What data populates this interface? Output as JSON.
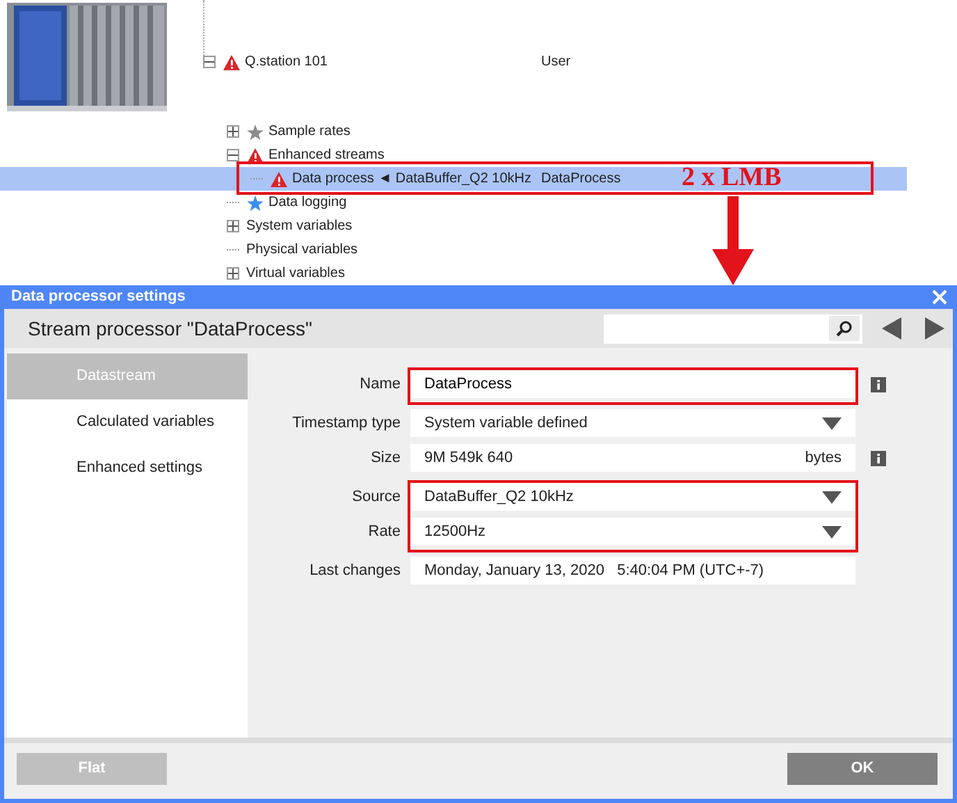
{
  "tree": {
    "items": [
      {
        "label": "Q.station 101",
        "column_2": "User",
        "kind": "alert",
        "expanded": true,
        "selected": false,
        "children": [
          {
            "label": "Sample rates",
            "kind": "setting",
            "expanded": false,
            "selected": false
          },
          {
            "label": "Enhanced streams",
            "kind": "alert",
            "expanded": true,
            "selected": false,
            "children": [
              {
                "label": "Data process ◄ DataBuffer_Q2 10kHz",
                "column_2": "DataProcess",
                "kind": "alert",
                "selected": true
              }
            ]
          },
          {
            "label": "Data logging",
            "kind": "logging",
            "selected": false
          },
          {
            "label": "System variables",
            "expanded": false,
            "selected": false
          },
          {
            "label": "Physical variables",
            "selected": false
          },
          {
            "label": "Virtual variables",
            "expanded": false,
            "selected": false
          }
        ]
      }
    ]
  },
  "annotation": {
    "label": "2 x LMB"
  },
  "dialog": {
    "title": "Data processor settings",
    "heading": "Stream processor \"DataProcess\"",
    "sidebar": {
      "items": [
        {
          "label": "Datastream",
          "selected": true
        },
        {
          "label": "Calculated variables",
          "selected": false
        },
        {
          "label": "Enhanced settings",
          "selected": false
        }
      ]
    },
    "field_groups": [
      {
        "highlighted": true,
        "fields": [
          {
            "kind": "input",
            "label": "Name",
            "value": "DataProcess",
            "info": true
          }
        ]
      },
      {
        "highlighted": false,
        "fields": [
          {
            "kind": "dropdown",
            "label": "Timestamp type",
            "value": "System variable defined",
            "info": false
          },
          {
            "kind": "readonly",
            "label": "Size",
            "value": "9M 549k 640",
            "unit": "bytes",
            "info": true
          }
        ]
      },
      {
        "highlighted": true,
        "fields": [
          {
            "kind": "dropdown",
            "label": "Source",
            "value": "DataBuffer_Q2 10kHz",
            "info": false
          },
          {
            "kind": "dropdown",
            "label": "Rate",
            "value": "12500Hz",
            "info": false
          }
        ]
      },
      {
        "highlighted": false,
        "fields": [
          {
            "kind": "readonly",
            "label": "Last changes",
            "value": "Monday, January 13, 2020   5:40:04 PM (UTC+-7)",
            "info": false
          }
        ]
      }
    ],
    "buttons": [
      {
        "label": "Flat",
        "disabled": true
      },
      {
        "label": "OK",
        "disabled": false
      }
    ]
  }
}
